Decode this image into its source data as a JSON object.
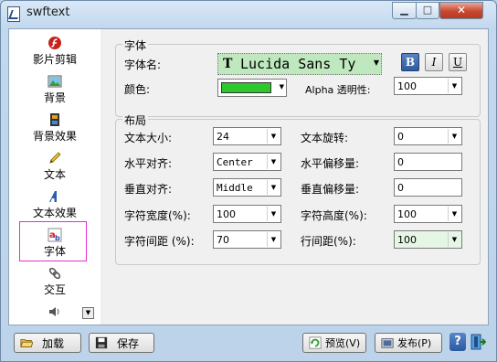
{
  "window": {
    "title": "swftext",
    "close_glyph": "✕",
    "min_glyph": "▁",
    "max_glyph": "□"
  },
  "sidebar": {
    "items": [
      {
        "label": "影片剪辑",
        "icon": "flash-icon"
      },
      {
        "label": "背景",
        "icon": "background-image-icon"
      },
      {
        "label": "背景效果",
        "icon": "film-effects-icon"
      },
      {
        "label": "文本",
        "icon": "pencil-icon"
      },
      {
        "label": "文本效果",
        "icon": "text-effect-icon"
      },
      {
        "label": "字体",
        "icon": "font-icon",
        "selected": true
      },
      {
        "label": "交互",
        "icon": "interaction-icon"
      },
      {
        "label": "",
        "icon": "sound-icon"
      }
    ],
    "scroll_glyph": "▼"
  },
  "font_group": {
    "title": "字体",
    "font_name_label": "字体名:",
    "font_name_value": "Lucida Sans Ty",
    "font_prefix_glyph": "T",
    "bold_label": "B",
    "italic_label": "I",
    "underline_label": "U",
    "color_label": "颜色:",
    "color_value": "#2ec82e",
    "alpha_label": "Alpha 透明性:",
    "alpha_value": "100"
  },
  "layout_group": {
    "title": "布局",
    "text_size_label": "文本大小:",
    "text_size_value": "24",
    "rotation_label": "文本旋转:",
    "rotation_value": "0",
    "halign_label": "水平对齐:",
    "halign_value": "Center",
    "hoffset_label": "水平偏移量:",
    "hoffset_value": "0",
    "valign_label": "垂直对齐:",
    "valign_value": "Middle",
    "voffset_label": "垂直偏移量:",
    "voffset_value": "0",
    "char_width_label": "字符宽度(%):",
    "char_width_value": "100",
    "char_height_label": "字符高度(%):",
    "char_height_value": "100",
    "char_spacing_label": "字符间距 (%):",
    "char_spacing_value": "70",
    "line_spacing_label": "行间距(%):",
    "line_spacing_value": "100",
    "dropdown_glyph": "▼"
  },
  "bottom": {
    "load_label": "加载",
    "save_label": "保存",
    "preview_label": "预览(V)",
    "publish_label": "发布(P)",
    "help_label": "?"
  }
}
